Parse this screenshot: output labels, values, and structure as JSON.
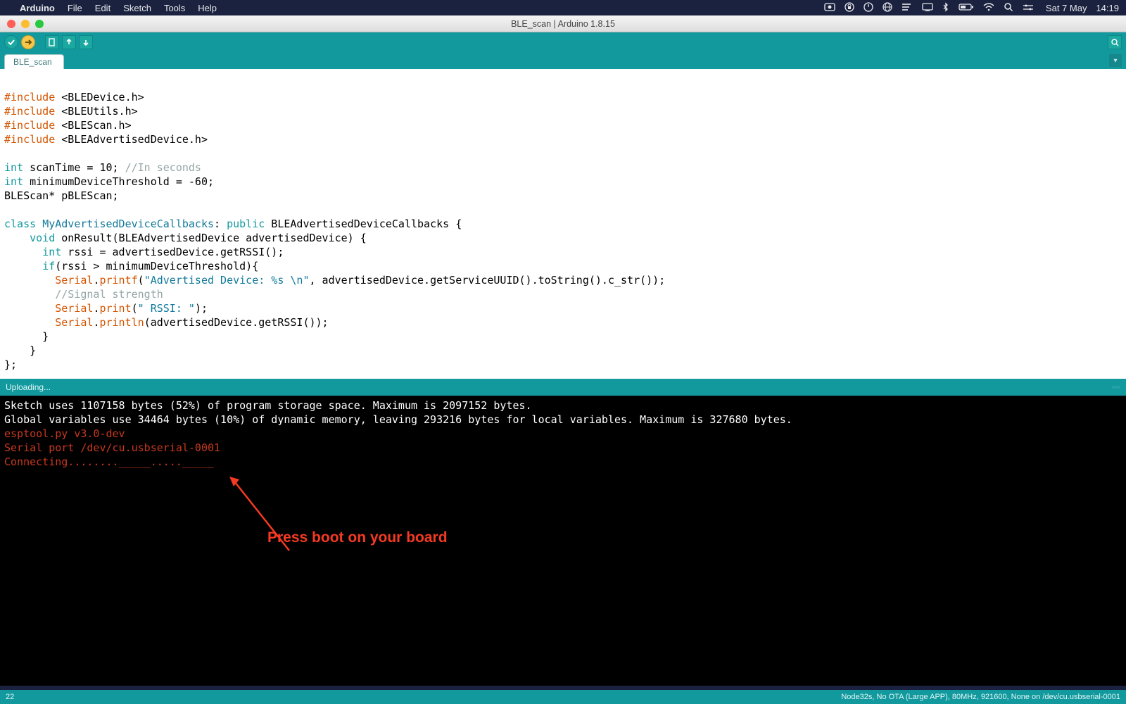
{
  "mac_menu": {
    "app": "Arduino",
    "items": [
      "File",
      "Edit",
      "Sketch",
      "Tools",
      "Help"
    ],
    "date": "Sat 7 May",
    "time": "14:19"
  },
  "window": {
    "title": "BLE_scan | Arduino 1.8.15"
  },
  "tabs": {
    "active": "BLE_scan"
  },
  "code": {
    "lines": [
      {
        "t": "inc",
        "raw": "#include <BLEDevice.h>"
      },
      {
        "t": "inc",
        "raw": "#include <BLEUtils.h>"
      },
      {
        "t": "inc",
        "raw": "#include <BLEScan.h>"
      },
      {
        "t": "inc",
        "raw": "#include <BLEAdvertisedDevice.h>"
      },
      {
        "t": "blank",
        "raw": ""
      },
      {
        "t": "decl",
        "raw": "int scanTime = 10; //In seconds"
      },
      {
        "t": "decl2",
        "raw": "int minimumDeviceThreshold = -60;"
      },
      {
        "t": "plain",
        "raw": "BLEScan* pBLEScan;"
      },
      {
        "t": "blank",
        "raw": ""
      },
      {
        "t": "cls",
        "raw": "class MyAdvertisedDeviceCallbacks: public BLEAdvertisedDeviceCallbacks {"
      },
      {
        "t": "void",
        "raw": "    void onResult(BLEAdvertisedDevice advertisedDevice) {"
      },
      {
        "t": "int",
        "raw": "      int rssi = advertisedDevice.getRSSI();"
      },
      {
        "t": "if",
        "raw": "      if(rssi > minimumDeviceThreshold){"
      },
      {
        "t": "ser1",
        "raw": "        Serial.printf(\"Advertised Device: %s \\n\", advertisedDevice.getServiceUUID().toString().c_str());"
      },
      {
        "t": "cmt",
        "raw": "        //Signal strength"
      },
      {
        "t": "ser2",
        "raw": "        Serial.print(\" RSSI: \");"
      },
      {
        "t": "ser3",
        "raw": "        Serial.println(advertisedDevice.getRSSI());"
      },
      {
        "t": "plain",
        "raw": "      }"
      },
      {
        "t": "plain",
        "raw": "    }"
      },
      {
        "t": "plain",
        "raw": "};"
      }
    ]
  },
  "status": {
    "text": "Uploading...",
    "copy_hint": ""
  },
  "console": {
    "lines": [
      {
        "cls": "",
        "text": "Sketch uses 1107158 bytes (52%) of program storage space. Maximum is 2097152 bytes."
      },
      {
        "cls": "",
        "text": "Global variables use 34464 bytes (10%) of dynamic memory, leaving 293216 bytes for local variables. Maximum is 327680 bytes."
      },
      {
        "cls": "err",
        "text": "esptool.py v3.0-dev"
      },
      {
        "cls": "err",
        "text": "Serial port /dev/cu.usbserial-0001"
      },
      {
        "cls": "err",
        "text": "Connecting........_____....._____"
      }
    ]
  },
  "annotation": {
    "text": "Press boot on your board"
  },
  "bottombar": {
    "left": "22",
    "right": "Node32s, No OTA (Large APP), 80MHz, 921600, None on /dev/cu.usbserial-0001"
  },
  "colors": {
    "teal": "#12999e",
    "accent": "#f7c548",
    "error": "#c8381e",
    "annotation": "#f53a23"
  }
}
